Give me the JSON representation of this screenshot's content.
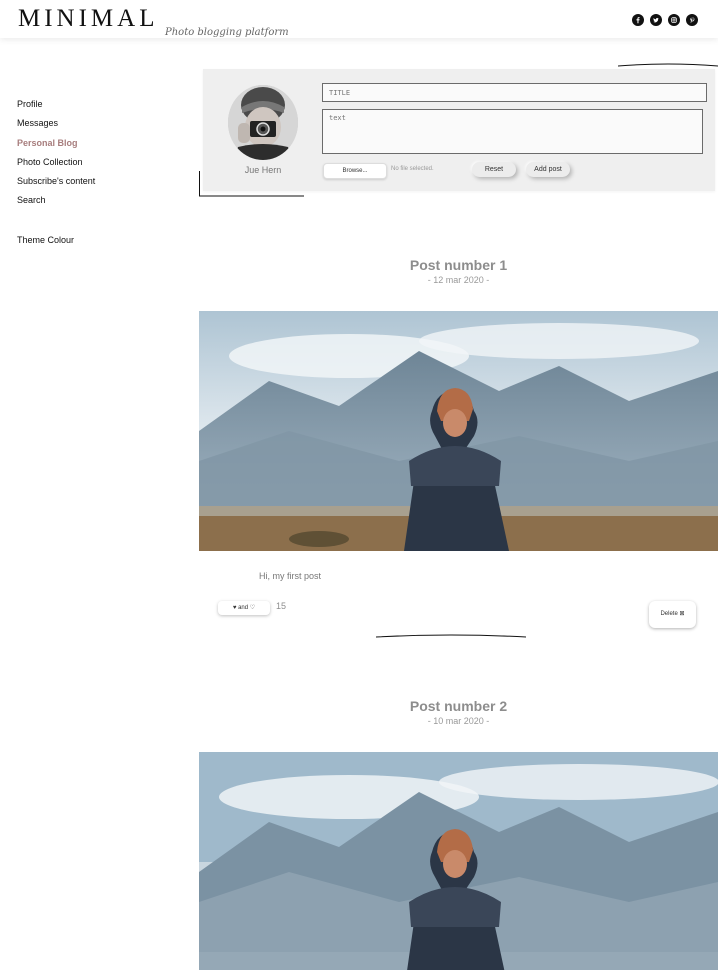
{
  "header": {
    "logo": "MINIMAL",
    "tagline": "Photo blogging platform",
    "social_icons": [
      "facebook-icon",
      "twitter-icon",
      "instagram-icon",
      "pinterest-icon"
    ]
  },
  "sidebar": {
    "items": [
      {
        "label": "Profile"
      },
      {
        "label": "Messages"
      },
      {
        "label": "Personal Blog",
        "active": true
      },
      {
        "label": "Photo Collection"
      },
      {
        "label": "Subscribe's content"
      },
      {
        "label": "Search"
      }
    ],
    "theme_label": "Theme Colour"
  },
  "composer": {
    "username": "Jue Hern",
    "title_placeholder": "TITLE",
    "text_placeholder": "text",
    "browse_label": "Browse...",
    "no_file_label": "No file selected.",
    "reset_label": "Reset",
    "add_post_label": "Add post"
  },
  "posts": [
    {
      "title": "Post number 1",
      "date": "- 12 mar 2020 -",
      "text": "Hi, my first post",
      "like_label": "♥ and ♡",
      "like_count": "15",
      "delete_label": "Delete ⊠"
    },
    {
      "title": "Post number 2",
      "date": "- 10 mar 2020 -"
    }
  ],
  "colors": {
    "accent": "#a77d7d",
    "panel": "#efefef",
    "muted_text": "#8d8d8d"
  }
}
